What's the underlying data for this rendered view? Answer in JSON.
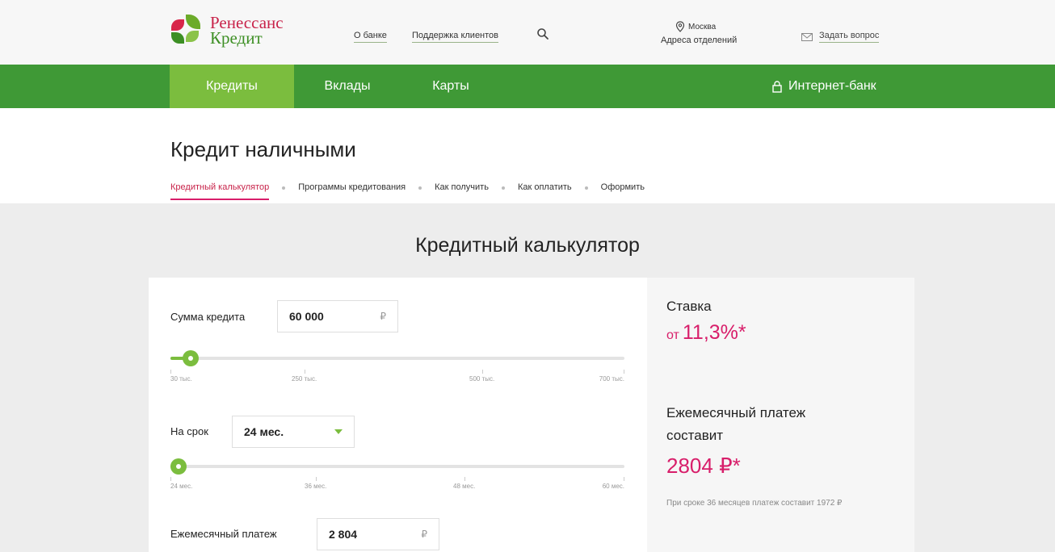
{
  "header": {
    "logo_line1": "Ренессанс",
    "logo_line2": "Кредит",
    "links": [
      "О банке",
      "Поддержка клиентов"
    ],
    "city": "Москва",
    "branches": "Адреса отделений",
    "ask": "Задать вопрос"
  },
  "nav": {
    "items": [
      "Кредиты",
      "Вклады",
      "Карты"
    ],
    "active_index": 0,
    "internet_bank": "Интернет-банк"
  },
  "page": {
    "title": "Кредит наличными",
    "subnav": [
      "Кредитный калькулятор",
      "Программы кредитования",
      "Как получить",
      "Как оплатить",
      "Оформить"
    ],
    "subnav_active": 0
  },
  "calculator": {
    "title": "Кредитный калькулятор",
    "amount": {
      "label": "Сумма кредита",
      "value": "60 000",
      "currency": "₽",
      "ticks": [
        "30 тыс.",
        "250 тыс.",
        "500 тыс.",
        "700 тыс."
      ],
      "slider_fraction": 0.045
    },
    "term": {
      "label": "На срок",
      "value": "24 мес.",
      "ticks": [
        "24 мес.",
        "36 мес.",
        "48 мес.",
        "60 мес."
      ],
      "slider_fraction": 0.0
    },
    "monthly": {
      "label": "Ежемесячный платеж",
      "value": "2 804",
      "currency": "₽"
    }
  },
  "result": {
    "rate_label": "Ставка",
    "rate_prefix": "от",
    "rate_value": "11,3%*",
    "payment_label_line1": "Ежемесячный платеж",
    "payment_label_line2": "составит",
    "payment_value": "2804 ₽*",
    "note": "При сроке 36 месяцев платеж составит 1972 ₽"
  },
  "colors": {
    "brand_green": "#3f9936",
    "accent_green": "#7bbd3e",
    "accent_pink": "#d81e6a"
  }
}
